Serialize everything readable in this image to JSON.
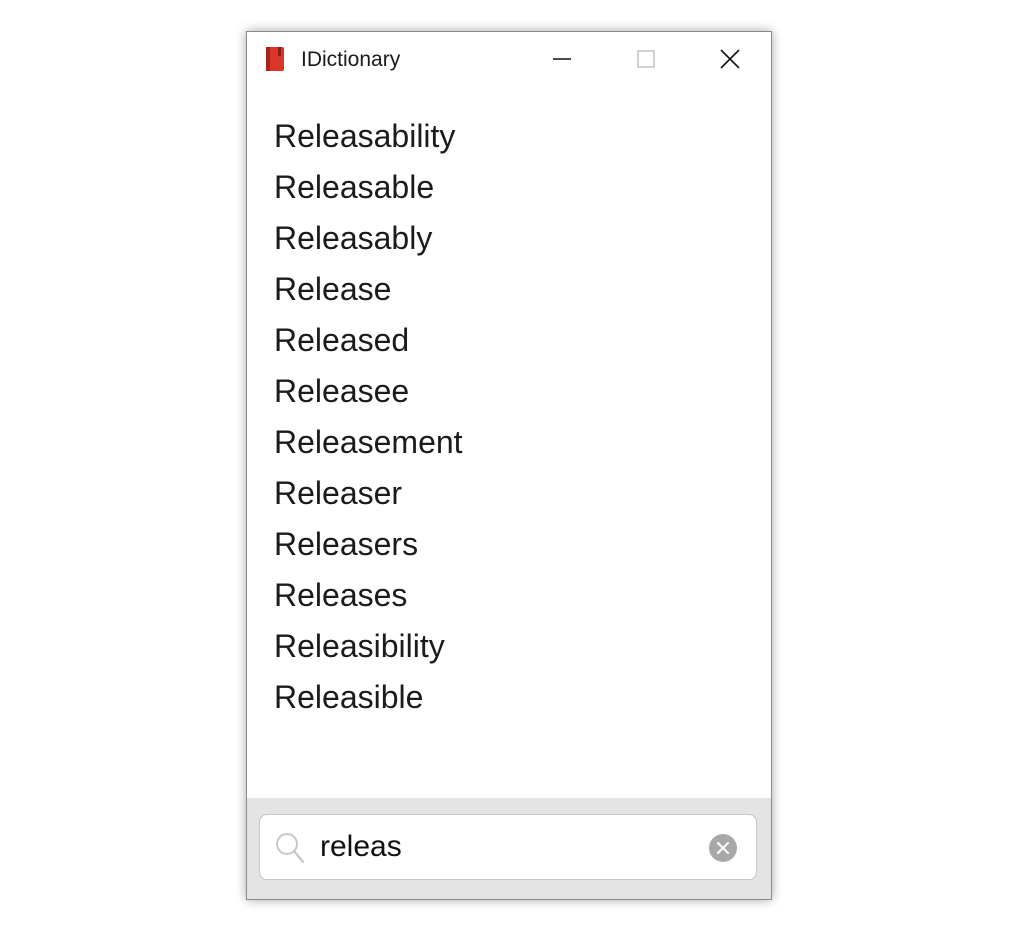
{
  "window": {
    "title": "IDictionary",
    "icon": "red-book-icon",
    "controls": [
      "minimize-icon",
      "maximize-icon",
      "close-icon"
    ]
  },
  "results": [
    "Releasability",
    "Releasable",
    "Releasably",
    "Release",
    "Released",
    "Releasee",
    "Releasement",
    "Releaser",
    "Releasers",
    "Releases",
    "Releasibility",
    "Releasible"
  ],
  "search": {
    "value": "releas",
    "icon": "search-icon",
    "clear_icon": "clear-icon"
  },
  "colors": {
    "icon_red": "#d9352b",
    "footer_bg": "#e4e4e4",
    "clear_grey": "#a8a8a8"
  }
}
